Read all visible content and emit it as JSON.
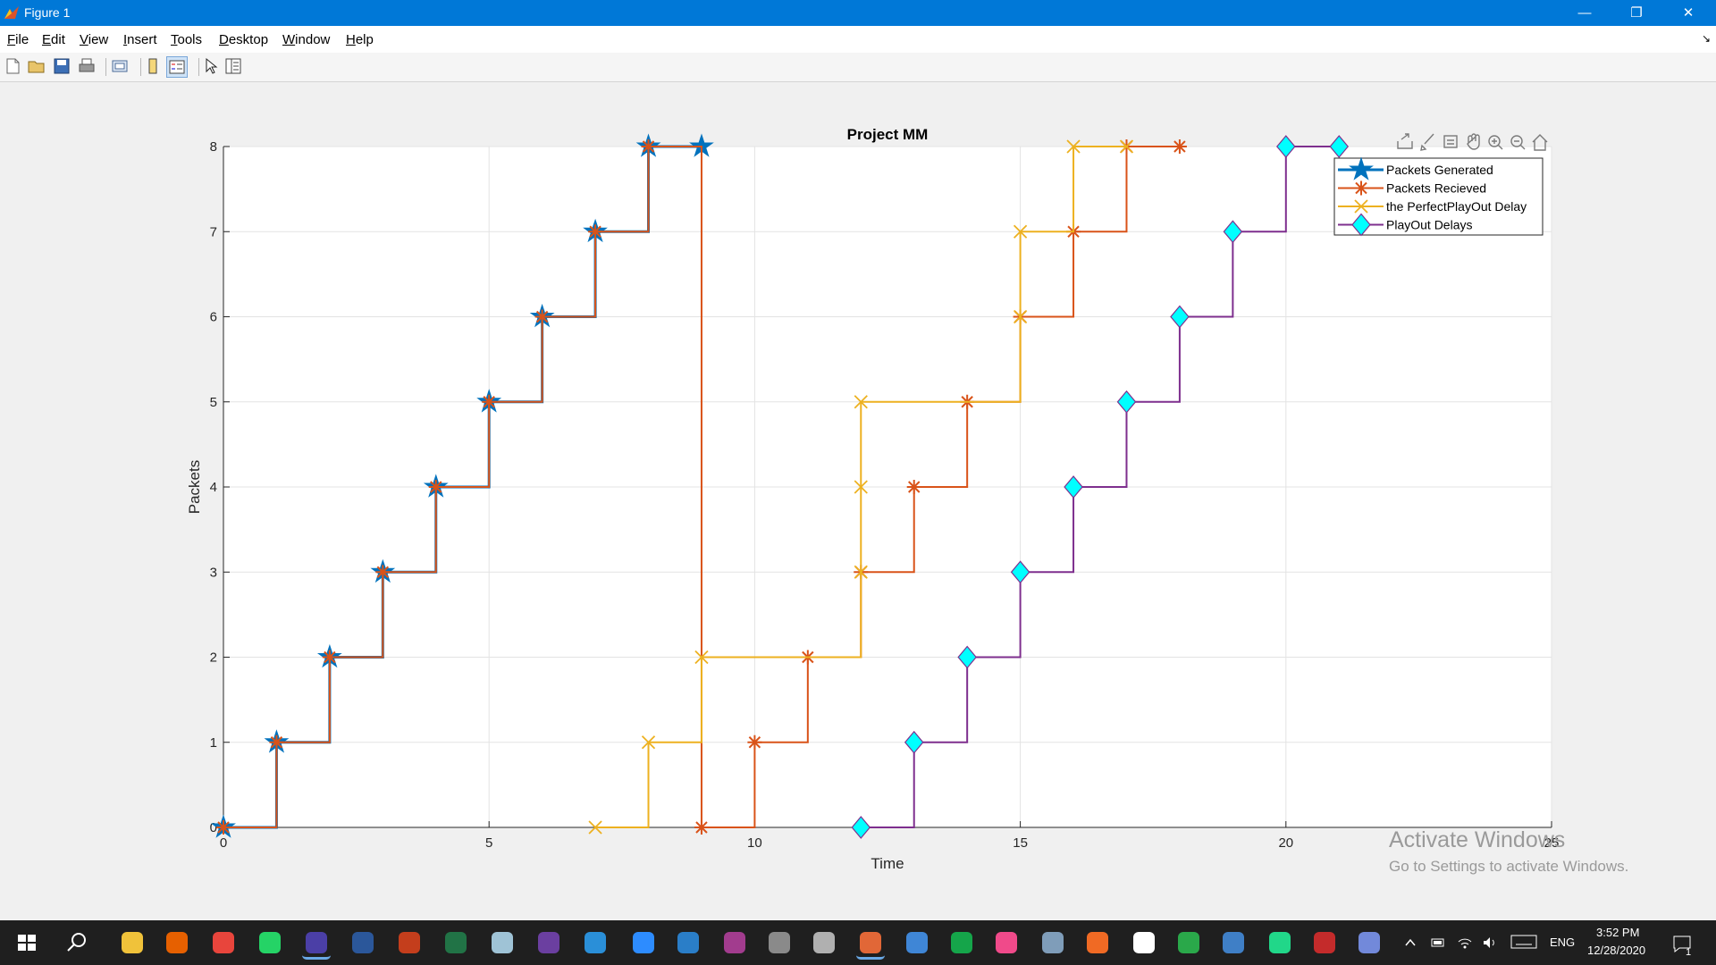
{
  "window": {
    "title": "Figure 1"
  },
  "menu": [
    {
      "label": "File",
      "hot": "F",
      "rest": "ile"
    },
    {
      "label": "Edit",
      "hot": "E",
      "rest": "dit"
    },
    {
      "label": "View",
      "hot": "V",
      "rest": "iew"
    },
    {
      "label": "Insert",
      "hot": "I",
      "rest": "nsert"
    },
    {
      "label": "Tools",
      "hot": "T",
      "rest": "ools"
    },
    {
      "label": "Desktop",
      "hot": "D",
      "rest": "esktop"
    },
    {
      "label": "Window",
      "hot": "W",
      "rest": "indow"
    },
    {
      "label": "Help",
      "hot": "H",
      "rest": "elp"
    }
  ],
  "toolbar_icons": [
    "new-figure-icon",
    "open-file-icon",
    "save-icon",
    "print-icon",
    "link-plot-icon",
    "insert-colorbar-icon",
    "insert-legend-icon",
    "edit-plot-icon",
    "property-inspector-icon"
  ],
  "axes_toolbar_icons": [
    "export-icon",
    "brush-icon",
    "data-tips-icon",
    "pan-icon",
    "zoom-in-icon",
    "zoom-out-icon",
    "home-icon"
  ],
  "chart_data": {
    "type": "line",
    "title": "Project MM",
    "xlabel": "Time",
    "ylabel": "Packets",
    "xlim": [
      0,
      25
    ],
    "ylim": [
      0,
      8
    ],
    "xticks": [
      0,
      5,
      10,
      15,
      20,
      25
    ],
    "yticks": [
      0,
      1,
      2,
      3,
      4,
      5,
      6,
      7,
      8
    ],
    "grid": true,
    "legend_position": "top-right",
    "series": [
      {
        "name": "Packets Generated",
        "color": "#0072bd",
        "marker": "star",
        "x": [
          0,
          1,
          2,
          3,
          4,
          5,
          6,
          7,
          8,
          9
        ],
        "y": [
          0,
          1,
          2,
          3,
          4,
          5,
          6,
          7,
          8,
          8
        ]
      },
      {
        "name": "Packets Recieved",
        "color": "#d95319",
        "marker": "asterisk",
        "x": [
          0,
          1,
          2,
          3,
          4,
          5,
          6,
          7,
          8,
          9,
          10,
          11,
          12,
          13,
          14,
          15,
          16,
          17,
          18
        ],
        "y": [
          0,
          1,
          2,
          3,
          4,
          5,
          6,
          7,
          8,
          0,
          1,
          2,
          3,
          4,
          5,
          6,
          7,
          8,
          8
        ]
      },
      {
        "name": "the PerfectPlayOut Delay",
        "color": "#edb120",
        "marker": "x",
        "x": [
          7,
          8,
          9,
          12,
          12,
          12,
          15,
          15,
          16,
          17
        ],
        "y": [
          0,
          1,
          2,
          3,
          4,
          5,
          6,
          7,
          8,
          8
        ]
      },
      {
        "name": "PlayOut Delays",
        "color": "#7e2f8e",
        "marker": "diamond",
        "markerFill": "#00ffff",
        "x": [
          12,
          13,
          14,
          15,
          16,
          17,
          18,
          19,
          20,
          21
        ],
        "y": [
          0,
          1,
          2,
          3,
          4,
          5,
          6,
          7,
          8,
          8
        ]
      }
    ]
  },
  "watermark": {
    "line1": "Activate Windows",
    "line2": "Go to Settings to activate Windows."
  },
  "taskbar": {
    "icons": [
      "windows-start-icon",
      "search-icon",
      "file-explorer-icon",
      "firefox-icon",
      "chrome-icon",
      "whatsapp-icon",
      "app-f-icon",
      "word-icon",
      "powerpoint-icon",
      "excel-icon",
      "notepad-icon",
      "visual-studio-icon",
      "vscode-icon",
      "zoom-icon",
      "photos-icon",
      "media-icon",
      "audio-icon",
      "scanner-icon",
      "matlab-icon",
      "qbittorrent-icon",
      "upwork-icon",
      "itunes-icon",
      "browser-icon",
      "orange-app-icon",
      "green-app-icon",
      "refresh-app-icon",
      "network-app-icon",
      "pycharm-icon",
      "app-red-icon",
      "discord-icon"
    ],
    "language": "ENG",
    "time": "3:52 PM",
    "date": "12/28/2020",
    "notification_count": "1"
  }
}
